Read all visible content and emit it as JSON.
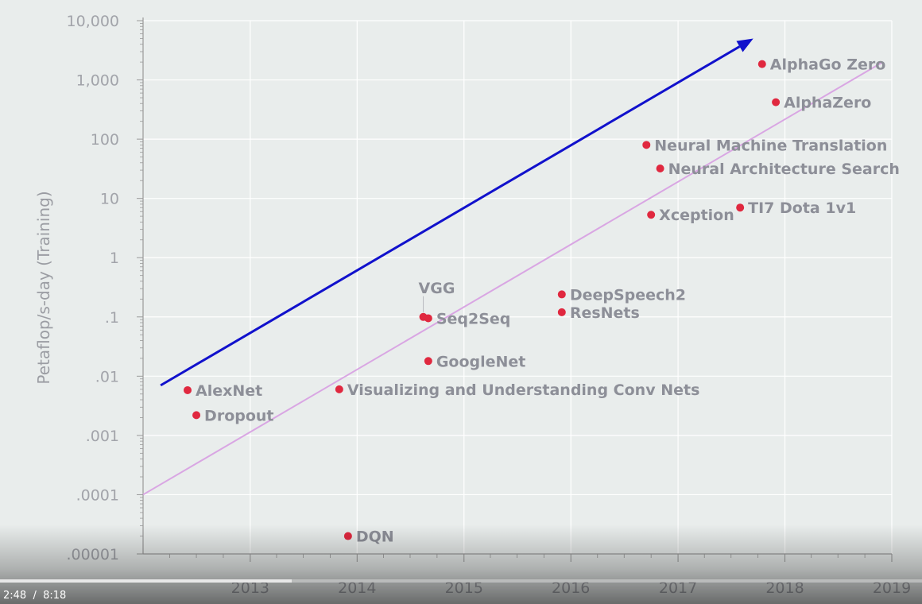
{
  "chart_data": {
    "type": "scatter",
    "title": "",
    "ylabel": "Petaflop/s-day (Training)",
    "xlabel": "",
    "y_scale": "log",
    "ylim": [
      1e-05,
      10000
    ],
    "xlim": [
      "2012-01-01",
      "2019-01-01"
    ],
    "x_tick_labels": [
      "2013",
      "2014",
      "2015",
      "2016",
      "2017",
      "2018",
      "2019"
    ],
    "y_tick_labels": [
      ".00001",
      ".0001",
      ".001",
      ".01",
      ".1",
      "1",
      "10",
      "100",
      "1,000",
      "10,000"
    ],
    "grid": true,
    "points": [
      {
        "label": "AlexNet",
        "date": "2012-06-01",
        "value": 0.0058
      },
      {
        "label": "Dropout",
        "date": "2012-07-01",
        "value": 0.0022
      },
      {
        "label": "DQN",
        "date": "2013-12-01",
        "value": 2e-05
      },
      {
        "label": "Visualizing and Understanding Conv Nets",
        "date": "2013-11-01",
        "value": 0.006
      },
      {
        "label": "GoogleNet",
        "date": "2014-09-01",
        "value": 0.018
      },
      {
        "label": "VGG",
        "date": "2014-08-15",
        "value": 0.1
      },
      {
        "label": "Seq2Seq",
        "date": "2014-09-01",
        "value": 0.095
      },
      {
        "label": "DeepSpeech2",
        "date": "2015-12-01",
        "value": 0.24
      },
      {
        "label": "ResNets",
        "date": "2015-12-01",
        "value": 0.12
      },
      {
        "label": "Xception",
        "date": "2016-10-01",
        "value": 5.3
      },
      {
        "label": "TI7 Dota 1v1",
        "date": "2017-08-01",
        "value": 7
      },
      {
        "label": "Neural Machine Translation",
        "date": "2016-09-15",
        "value": 80
      },
      {
        "label": "Neural Architecture Search",
        "date": "2016-11-01",
        "value": 32
      },
      {
        "label": "AlphaGo Zero",
        "date": "2017-10-15",
        "value": 1850
      },
      {
        "label": "AlphaZero",
        "date": "2017-12-01",
        "value": 420
      }
    ],
    "trend_line": {
      "from": {
        "date": "2012-01-01",
        "value": 0.0001
      },
      "to": {
        "date": "2018-12-01",
        "value": 2000
      }
    },
    "arrow": {
      "from": {
        "date": "2012-03-01",
        "value": 0.007
      },
      "to": {
        "date": "2017-09-15",
        "value": 5000
      }
    },
    "colors": {
      "point": "#e0283f",
      "label": "#8d8f98",
      "tick_label": "#a2a4aa",
      "axis_title": "#9b9da3",
      "grid": "#ffffff",
      "axis_line": "#9a9a9a",
      "trend_line": "#d9a6e3",
      "arrow": "#1111cc",
      "background": "#e9edec"
    }
  },
  "player": {
    "current_time": "2:48",
    "separator": "/",
    "duration": "8:18",
    "progress_fraction": 0.316,
    "colors": {
      "progress": "#e8e8e8",
      "text": "#ffffff"
    }
  }
}
